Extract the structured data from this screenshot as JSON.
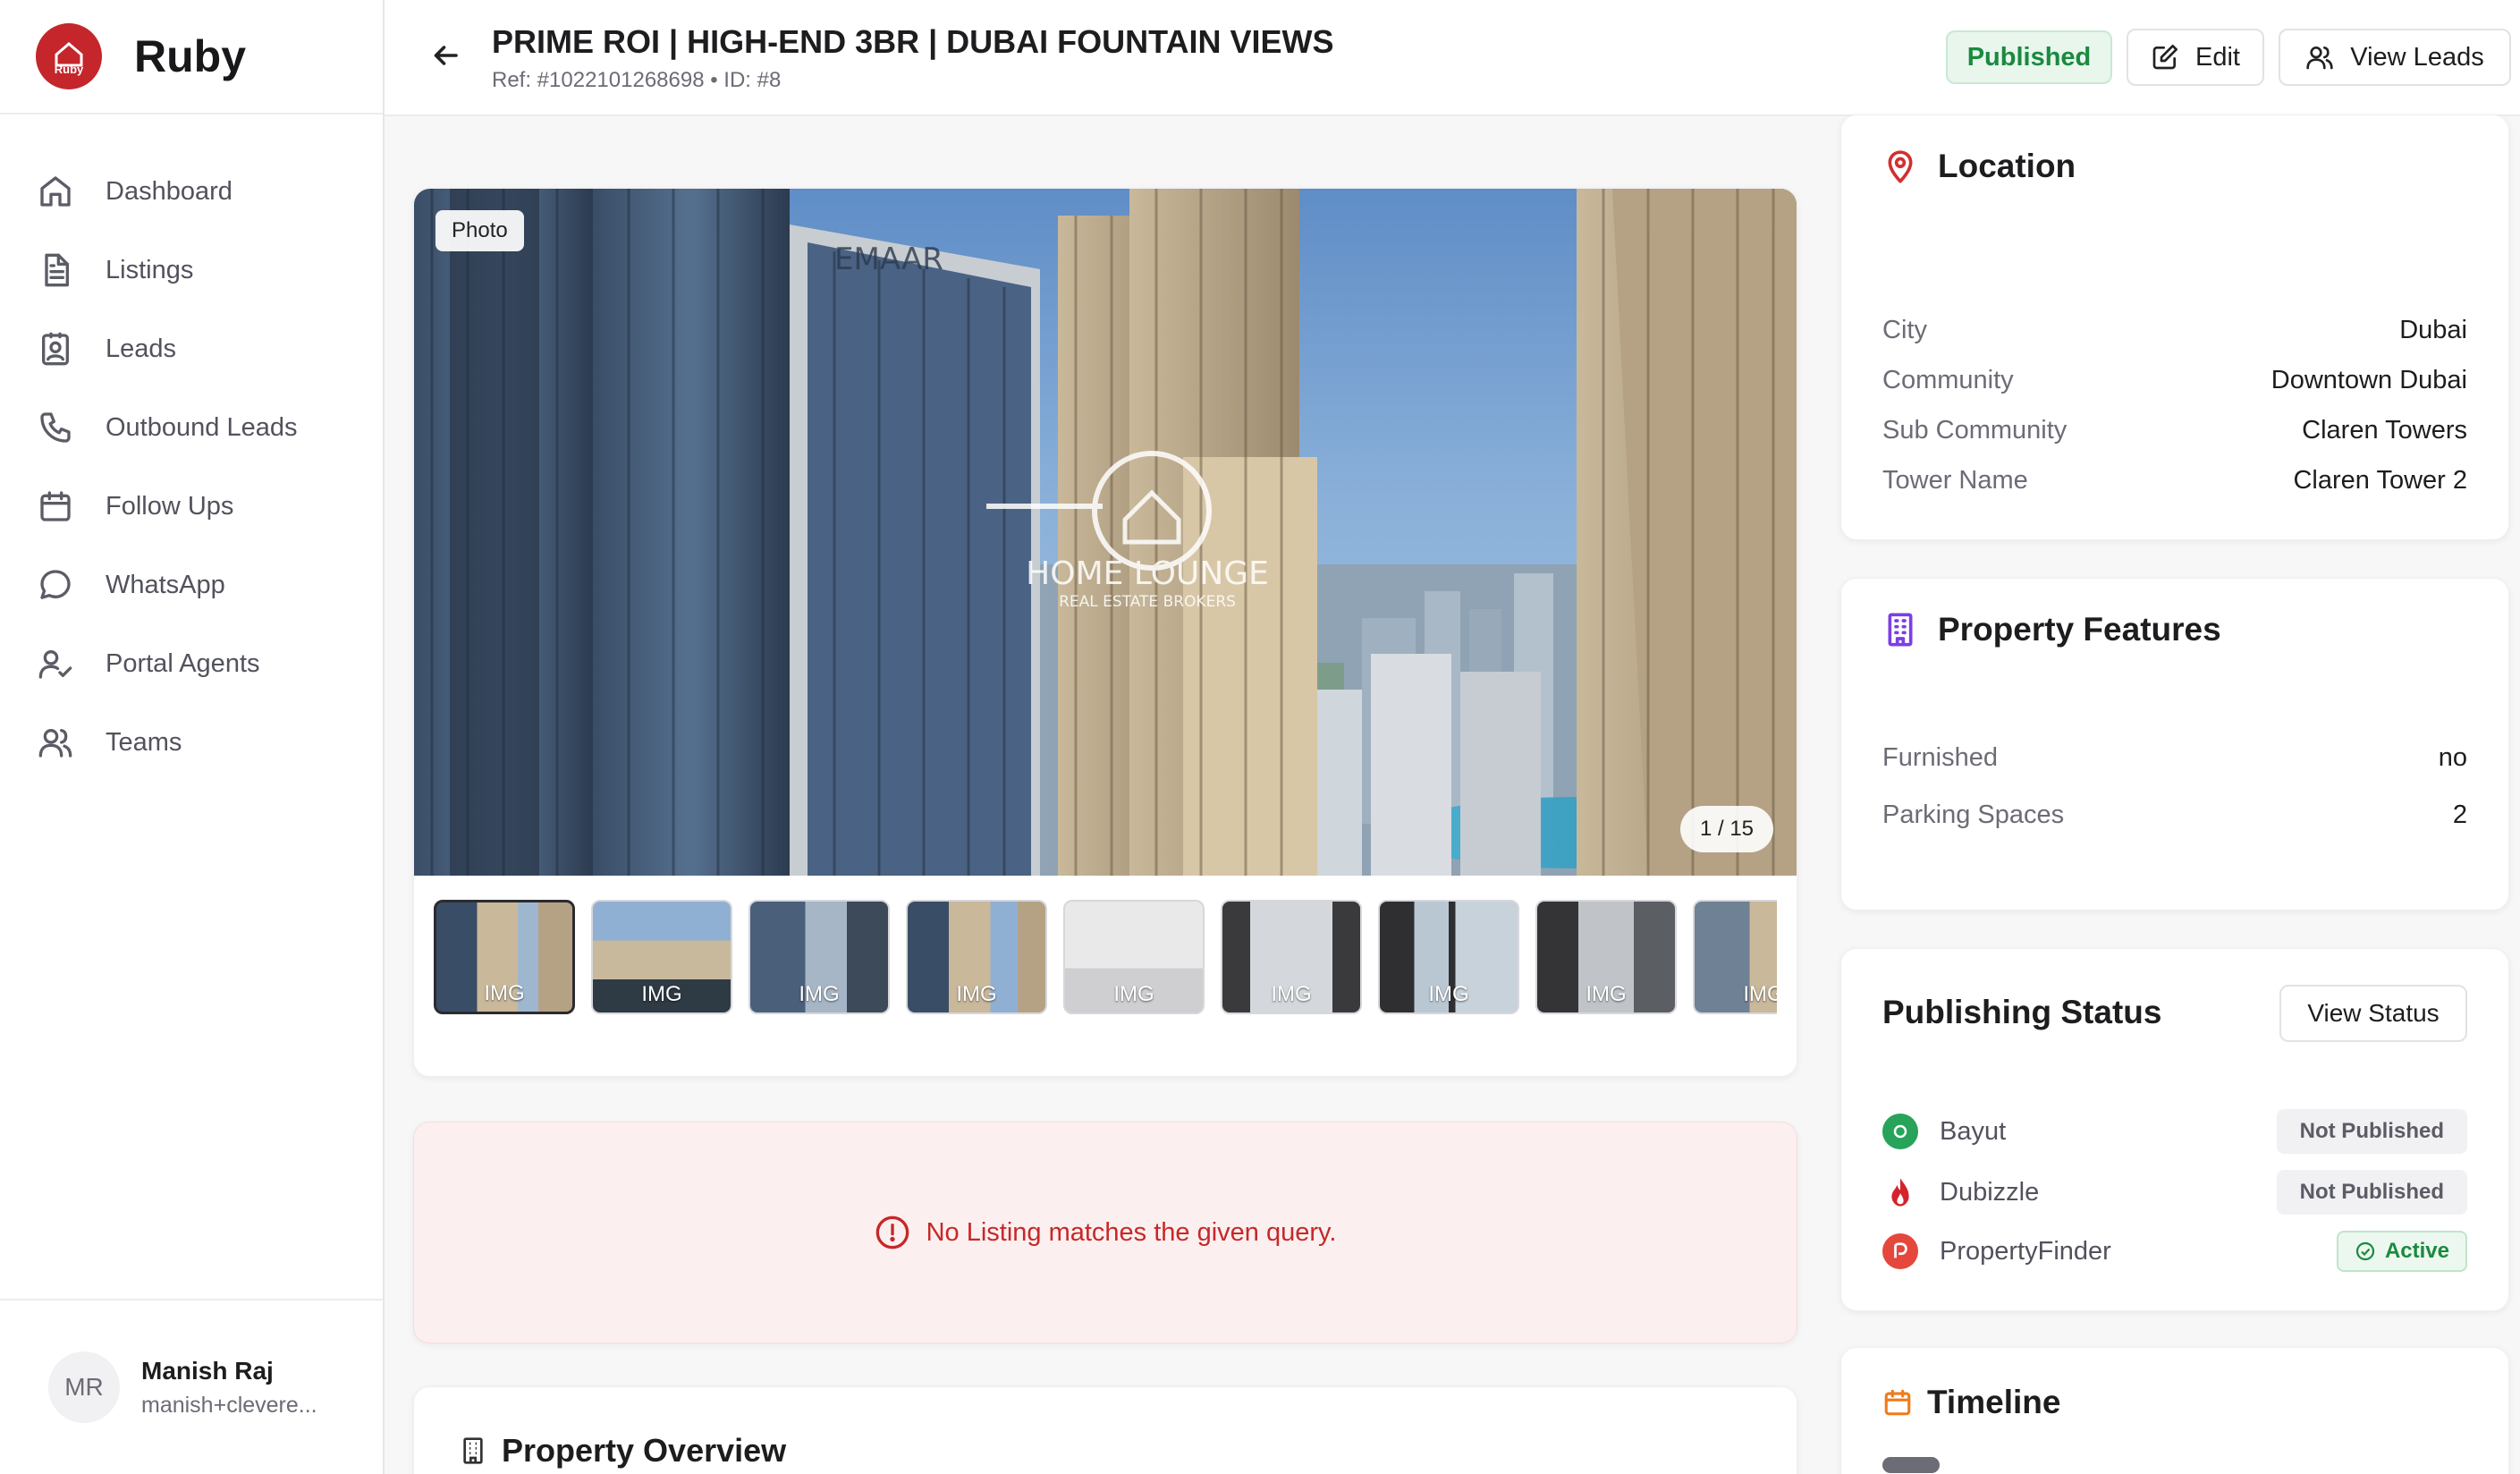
{
  "brand": {
    "name": "Ruby",
    "logo_text": "Ruby"
  },
  "nav": [
    {
      "label": "Dashboard",
      "icon": "home-icon"
    },
    {
      "label": "Listings",
      "icon": "document-icon"
    },
    {
      "label": "Leads",
      "icon": "contact-card-icon"
    },
    {
      "label": "Outbound Leads",
      "icon": "phone-icon"
    },
    {
      "label": "Follow Ups",
      "icon": "calendar-icon"
    },
    {
      "label": "WhatsApp",
      "icon": "chat-icon"
    },
    {
      "label": "Portal Agents",
      "icon": "user-check-icon"
    },
    {
      "label": "Teams",
      "icon": "users-icon"
    }
  ],
  "user": {
    "initials": "MR",
    "name": "Manish Raj",
    "email": "manish+clevere..."
  },
  "header": {
    "title": "PRIME ROI | HIGH-END 3BR | DUBAI FOUNTAIN VIEWS",
    "subtitle": "Ref: #1022101268698 • ID: #8",
    "status": "Published",
    "edit_label": "Edit",
    "view_leads_label": "View Leads"
  },
  "gallery": {
    "tag": "Photo",
    "counter": "1 / 15",
    "watermark_line1": "HOME LOUNGE",
    "watermark_line2": "REAL ESTATE BROKERS",
    "building_sign": "EMAAR",
    "thumbs": [
      "IMG",
      "IMG",
      "IMG",
      "IMG",
      "IMG",
      "IMG",
      "IMG",
      "IMG",
      "IMG"
    ]
  },
  "error": {
    "message": "No Listing matches the given query."
  },
  "overview": {
    "title": "Property Overview"
  },
  "location": {
    "title": "Location",
    "rows": [
      {
        "k": "City",
        "v": "Dubai"
      },
      {
        "k": "Community",
        "v": "Downtown Dubai"
      },
      {
        "k": "Sub Community",
        "v": "Claren Towers"
      },
      {
        "k": "Tower Name",
        "v": "Claren Tower 2"
      }
    ]
  },
  "features": {
    "title": "Property Features",
    "rows": [
      {
        "k": "Furnished",
        "v": "no"
      },
      {
        "k": "Parking Spaces",
        "v": "2"
      }
    ]
  },
  "publishing": {
    "title": "Publishing Status",
    "view_status_label": "View Status",
    "portals": [
      {
        "name": "Bayut",
        "status": "Not Published",
        "color": "#27a35a"
      },
      {
        "name": "Dubizzle",
        "status": "Not Published",
        "color": "#d4232b"
      },
      {
        "name": "PropertyFinder",
        "status": "Active",
        "color": "#e5473c"
      }
    ]
  },
  "timeline": {
    "title": "Timeline"
  },
  "colors": {
    "accent": "#c4262b",
    "success": "#1a8a3f",
    "error": "#c62828"
  }
}
